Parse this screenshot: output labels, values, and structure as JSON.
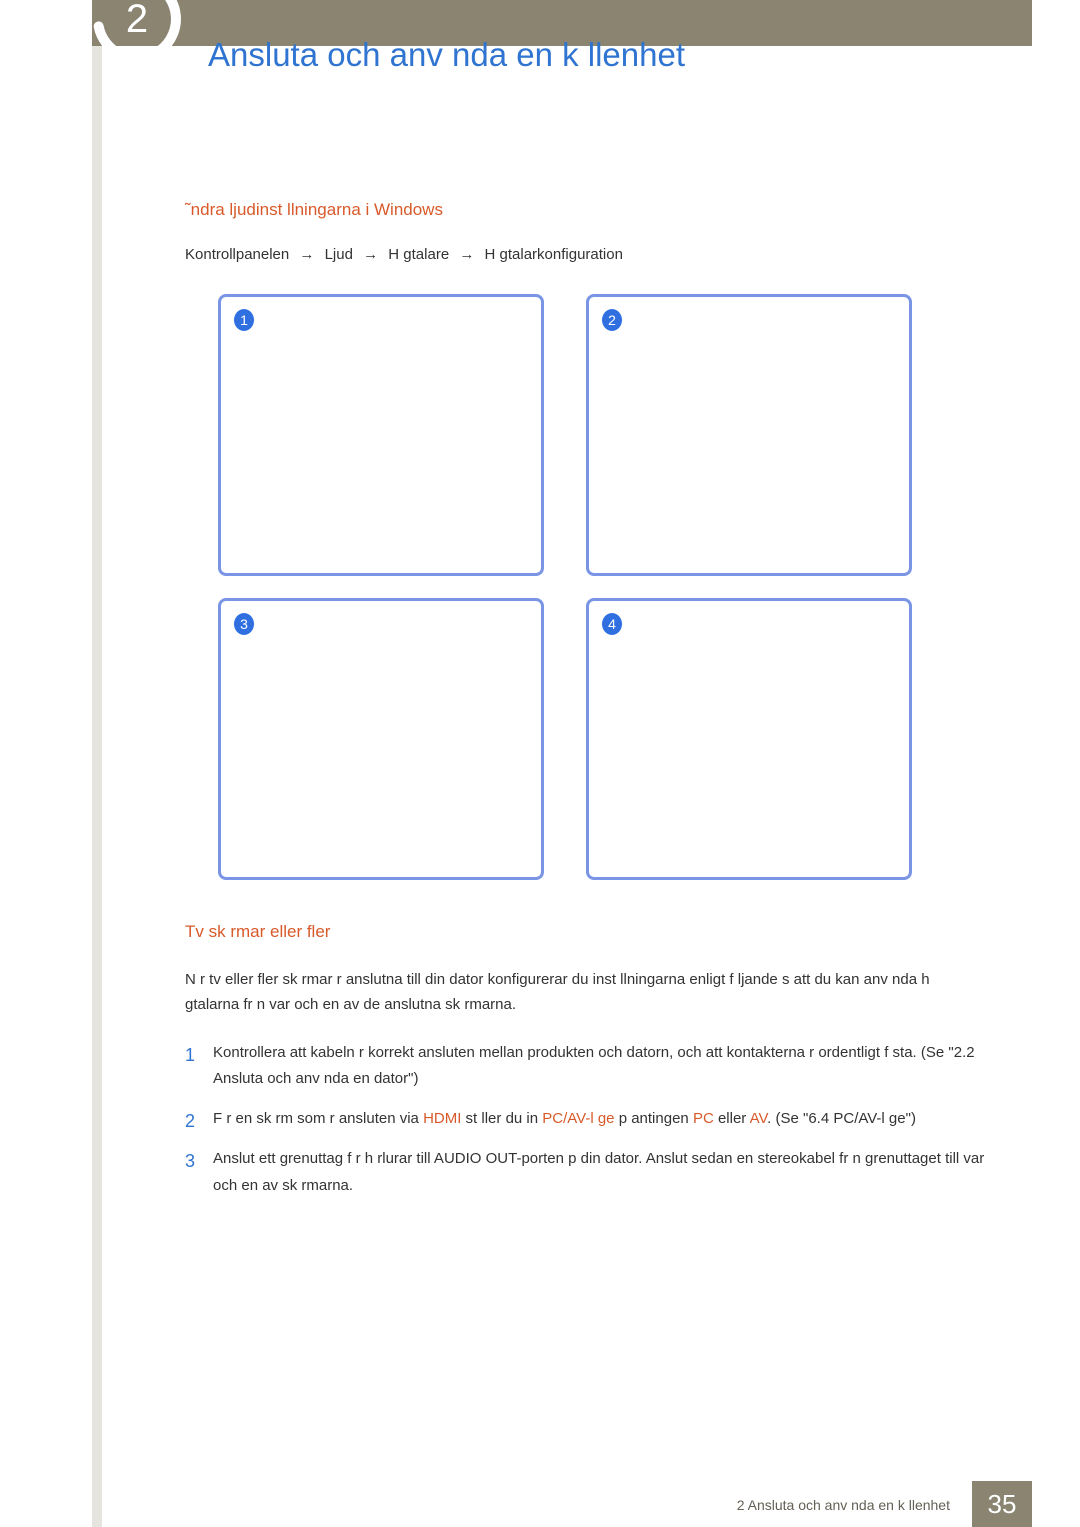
{
  "page_title": "Ansluta och anv nda en k llenhet",
  "chapter_number": "2",
  "section1": {
    "heading": "˜ndra ljudinst llningarna i Windows",
    "breadcrumbs": [
      "Kontrollpanelen",
      "Ljud",
      "H gtalare",
      "H gtalarkonfiguration"
    ],
    "panels": [
      "1",
      "2",
      "3",
      "4"
    ]
  },
  "section2": {
    "heading": "Tv  sk rmar eller fler",
    "intro": "N r tv  eller fler sk rmar  r anslutna till din dator konfigurerar du inst llningarna enligt f ljande s  att du kan anv nda h gtalarna fr n var och en av de anslutna sk rmarna.",
    "steps": [
      {
        "num": "1",
        "parts": [
          {
            "t": "Kontrollera att kabeln  r korrekt ansluten mellan produkten och datorn, och att kontakterna  r ordentligt f sta. (Se \"2.2 Ansluta och anv nda en dator\")"
          }
        ]
      },
      {
        "num": "2",
        "parts": [
          {
            "t": "F r en sk rm som  r ansluten via "
          },
          {
            "t": "HDMI",
            "hl": true
          },
          {
            "t": " st ller du in "
          },
          {
            "t": "PC/AV-l ge",
            "hl": true
          },
          {
            "t": "  p  antingen "
          },
          {
            "t": "PC",
            "hl": true
          },
          {
            "t": " eller "
          },
          {
            "t": "AV",
            "hl": true
          },
          {
            "t": ". (Se \"6.4 PC/AV-l ge\")"
          }
        ]
      },
      {
        "num": "3",
        "parts": [
          {
            "t": "Anslut ett grenuttag f r h rlurar till AUDIO OUT-porten p  din dator. Anslut sedan en stereokabel fr n grenuttaget till var och en av sk rmarna."
          }
        ]
      }
    ]
  },
  "footer": {
    "chapter_label": "2 Ansluta och anv nda en k llenhet",
    "page_number": "35"
  }
}
